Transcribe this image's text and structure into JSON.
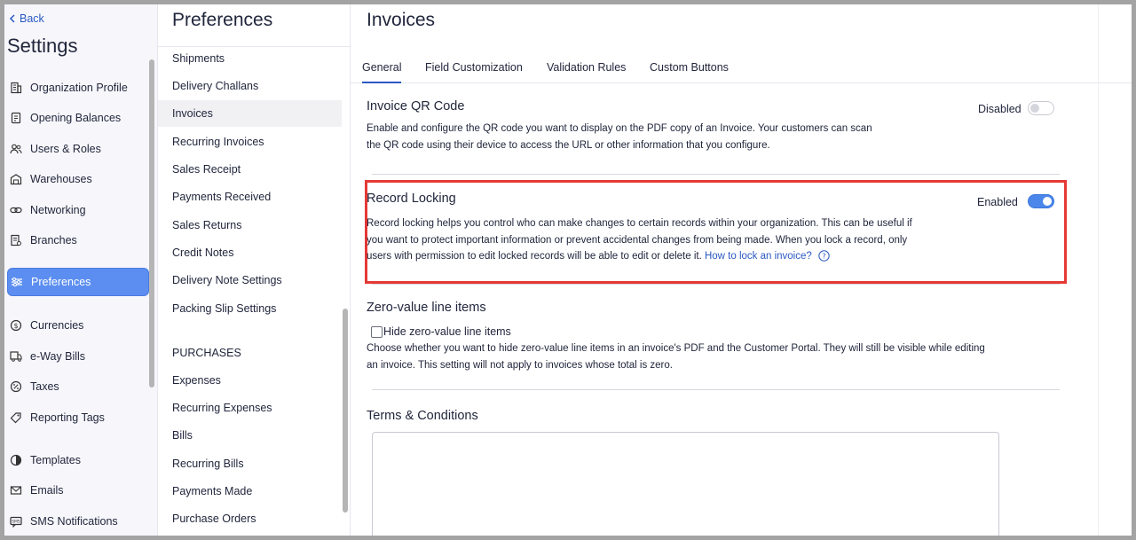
{
  "sidebar": {
    "back_label": "Back",
    "title": "Settings",
    "items": [
      {
        "label": "Organization Profile",
        "icon": "building-icon"
      },
      {
        "label": "Opening Balances",
        "icon": "ledger-icon"
      },
      {
        "label": "Users & Roles",
        "icon": "users-icon"
      },
      {
        "label": "Warehouses",
        "icon": "warehouse-icon"
      },
      {
        "label": "Networking",
        "icon": "link-icon"
      },
      {
        "label": "Branches",
        "icon": "branch-icon"
      },
      {
        "label": "Preferences",
        "icon": "sliders-icon"
      },
      {
        "label": "Currencies",
        "icon": "currency-icon"
      },
      {
        "label": "e-Way Bills",
        "icon": "truck-icon"
      },
      {
        "label": "Taxes",
        "icon": "percent-icon"
      },
      {
        "label": "Reporting Tags",
        "icon": "tag-icon"
      },
      {
        "label": "Templates",
        "icon": "template-icon"
      },
      {
        "label": "Emails",
        "icon": "mail-icon"
      },
      {
        "label": "SMS Notifications",
        "icon": "sms-icon"
      }
    ]
  },
  "preferences": {
    "title": "Preferences",
    "items": [
      "Shipments",
      "Delivery Challans",
      "Invoices",
      "Recurring Invoices",
      "Sales Receipt",
      "Payments Received",
      "Sales Returns",
      "Credit Notes",
      "Delivery Note Settings",
      "Packing Slip Settings"
    ],
    "purchases_heading": "PURCHASES",
    "purchase_items": [
      "Expenses",
      "Recurring Expenses",
      "Bills",
      "Recurring Bills",
      "Payments Made",
      "Purchase Orders"
    ]
  },
  "main": {
    "title": "Invoices",
    "tabs": [
      "General",
      "Field Customization",
      "Validation Rules",
      "Custom Buttons"
    ],
    "qr": {
      "title": "Invoice QR Code",
      "status": "Disabled",
      "desc_line1": "Enable and configure the QR code you want to display on the PDF copy of an Invoice. Your customers can scan",
      "desc_line2": "the QR code using their device to access the URL or other information that you configure."
    },
    "locking": {
      "title": "Record Locking",
      "status": "Enabled",
      "desc_line1": "Record locking helps you control who can make changes to certain records within your organization. This can be useful if",
      "desc_line2": "you want to protect important information or prevent accidental changes from being made. When you lock a record, only",
      "desc_line3": "users with permission to edit locked records will be able to edit or delete it.",
      "link": "How to lock an invoice?"
    },
    "zero": {
      "title": "Zero-value line items",
      "checkbox_label": "Hide zero-value line items",
      "desc_line1": "Choose whether you want to hide zero-value line items in an invoice's PDF and the Customer Portal. They will still be visible while editing",
      "desc_line2": "an invoice. This setting will not apply to invoices whose total is zero."
    },
    "terms": {
      "title": "Terms & Conditions"
    }
  },
  "colors": {
    "accent": "#2b59c3",
    "active_item": "#5b8ef0",
    "toggle_on": "#4b87eb",
    "highlight": "#e53935"
  }
}
